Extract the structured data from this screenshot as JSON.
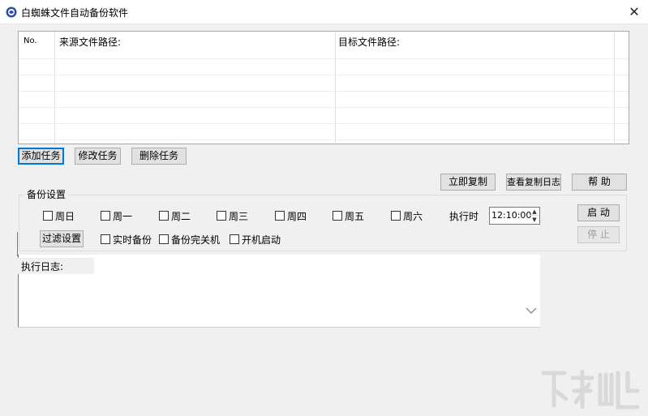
{
  "window": {
    "title": "白蜘蛛文件自动备份软件",
    "close_glyph": "✕"
  },
  "task_table": {
    "columns": [
      "No.",
      "来源文件路径:",
      "目标文件路径:"
    ],
    "rows": []
  },
  "task_buttons": {
    "add": "添加任务",
    "edit": "修改任务",
    "delete": "删除任务"
  },
  "action_buttons": {
    "copy_now": "立即复制",
    "view_log": "查看复制日志",
    "help": "帮 助"
  },
  "backup_settings": {
    "title": "备份设置",
    "weekdays": [
      {
        "label": "周日",
        "checked": false
      },
      {
        "label": "周一",
        "checked": false
      },
      {
        "label": "周二",
        "checked": false
      },
      {
        "label": "周三",
        "checked": false
      },
      {
        "label": "周四",
        "checked": false
      },
      {
        "label": "周五",
        "checked": false
      },
      {
        "label": "周六",
        "checked": false
      }
    ],
    "exec_time_label": "执行时",
    "exec_time_value": "12:10:00",
    "start_button": "启 动",
    "stop_button": "停 止",
    "filter_button": "过滤设置",
    "options": [
      {
        "label": "实时备份",
        "checked": false
      },
      {
        "label": "备份完关机",
        "checked": false
      },
      {
        "label": "开机启动",
        "checked": false
      }
    ]
  },
  "log": {
    "label": "执行日志:",
    "content": ""
  },
  "icons": {
    "app": "app-logo-icon",
    "close": "close-icon",
    "spin_up": "spin-up-icon",
    "spin_down": "spin-down-icon",
    "scroll": "chevron-down-icon"
  },
  "colors": {
    "focus_border": "#0078d7",
    "button_bg": "#e1e1e1",
    "window_bg": "#f0f0f0"
  }
}
